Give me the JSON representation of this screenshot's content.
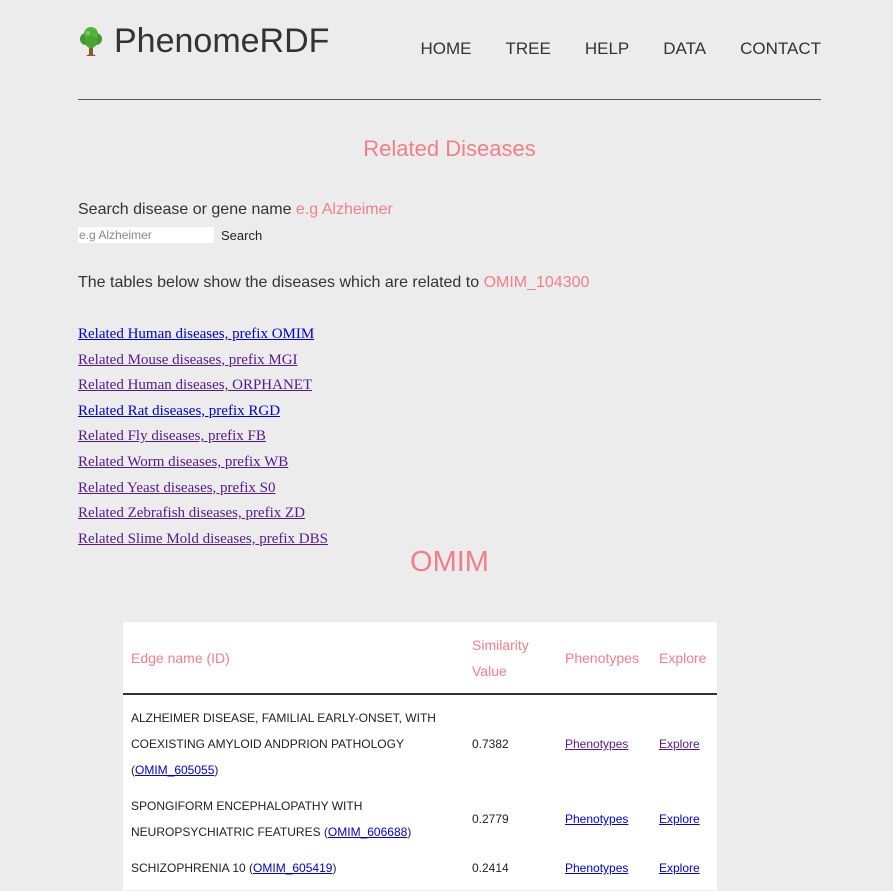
{
  "header": {
    "logo_text": "PhenomeRDF",
    "logo_icon": "tree-icon",
    "nav": [
      "HOME",
      "TREE",
      "HELP",
      "DATA",
      "CONTACT"
    ]
  },
  "page_title": "Related Diseases",
  "search": {
    "label": "Search disease or gene name ",
    "label_example": "e.g Alzheimer",
    "placeholder": "e.g Alzheimer",
    "value": "",
    "button_label": "Search"
  },
  "tables_description": {
    "text": "The tables below show the diseases which are related to ",
    "id": "OMIM_104300"
  },
  "related_links": [
    "Related Human diseases, prefix OMIM",
    "Related Mouse diseases, prefix MGI",
    "Related Human diseases, ORPHANET",
    "Related Rat diseases, prefix RGD",
    "Related Fly diseases, prefix FB",
    "Related Worm diseases, prefix WB",
    "Related Yeast diseases, prefix S0",
    "Related Zebrafish diseases, prefix ZD",
    "Related Slime Mold diseases, prefix DBS"
  ],
  "section_title": "OMIM",
  "table": {
    "headers": {
      "edge_name": "Edge name (ID)",
      "similarity_line1": "Similarity",
      "similarity_line2": "Value",
      "phenotypes": "Phenotypes",
      "explore": "Explore"
    },
    "rows": [
      {
        "name": "ALZHEIMER DISEASE, FAMILIAL EARLY-ONSET, WITH COEXISTING AMYLOID ANDPRION PATHOLOGY",
        "id": "OMIM_605055",
        "similarity": "0.7382",
        "phenotypes": "Phenotypes",
        "explore": "Explore"
      },
      {
        "name": "SPONGIFORM ENCEPHALOPATHY WITH NEUROPSYCHIATRIC FEATURES",
        "id": "OMIM_606688",
        "similarity": "0.2779",
        "phenotypes": "Phenotypes",
        "explore": "Explore"
      },
      {
        "name": "SCHIZOPHRENIA 10",
        "id": "OMIM_605419",
        "similarity": "0.2414",
        "phenotypes": "Phenotypes",
        "explore": "Explore"
      }
    ]
  },
  "colors": {
    "accent": "#f07f8c",
    "link": "#0000cc",
    "link_visited": "#551a8b",
    "background": "#ececec"
  }
}
